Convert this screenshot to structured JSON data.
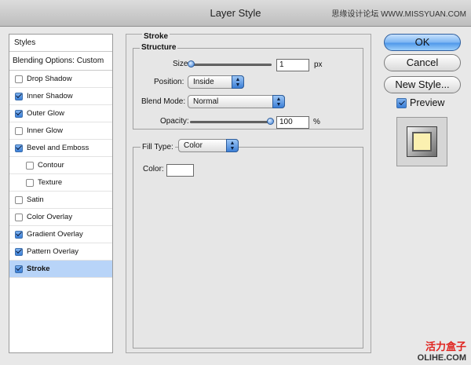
{
  "window": {
    "title": "Layer Style",
    "watermark_top": "思缘设计论坛 WWW.MISSYUAN.COM"
  },
  "sidebar": {
    "header": "Styles",
    "blending": "Blending Options: Custom",
    "items": [
      {
        "label": "Drop Shadow",
        "checked": false,
        "sub": false
      },
      {
        "label": "Inner Shadow",
        "checked": true,
        "sub": false
      },
      {
        "label": "Outer Glow",
        "checked": true,
        "sub": false
      },
      {
        "label": "Inner Glow",
        "checked": false,
        "sub": false
      },
      {
        "label": "Bevel and Emboss",
        "checked": true,
        "sub": false
      },
      {
        "label": "Contour",
        "checked": false,
        "sub": true
      },
      {
        "label": "Texture",
        "checked": false,
        "sub": true
      },
      {
        "label": "Satin",
        "checked": false,
        "sub": false
      },
      {
        "label": "Color Overlay",
        "checked": false,
        "sub": false
      },
      {
        "label": "Gradient Overlay",
        "checked": true,
        "sub": false
      },
      {
        "label": "Pattern Overlay",
        "checked": true,
        "sub": false
      },
      {
        "label": "Stroke",
        "checked": true,
        "sub": false,
        "selected": true
      }
    ]
  },
  "panel": {
    "title": "Stroke",
    "structure": {
      "title": "Structure",
      "size_label": "Size:",
      "size_value": "1",
      "size_unit": "px",
      "size_slider_fraction": 0.0,
      "position_label": "Position:",
      "position_value": "Inside",
      "blend_label": "Blend Mode:",
      "blend_value": "Normal",
      "opacity_label": "Opacity:",
      "opacity_value": "100",
      "opacity_unit": "%",
      "opacity_slider_fraction": 1.0
    },
    "fill": {
      "type_label": "Fill Type:",
      "type_value": "Color",
      "color_label": "Color:",
      "color_value": "#ffffff"
    }
  },
  "buttons": {
    "ok": "OK",
    "cancel": "Cancel",
    "new_style": "New Style..."
  },
  "preview": {
    "label": "Preview",
    "checked": true
  },
  "watermark_bottom": {
    "cn": "活力盒子",
    "en": "OLIHE.COM"
  }
}
